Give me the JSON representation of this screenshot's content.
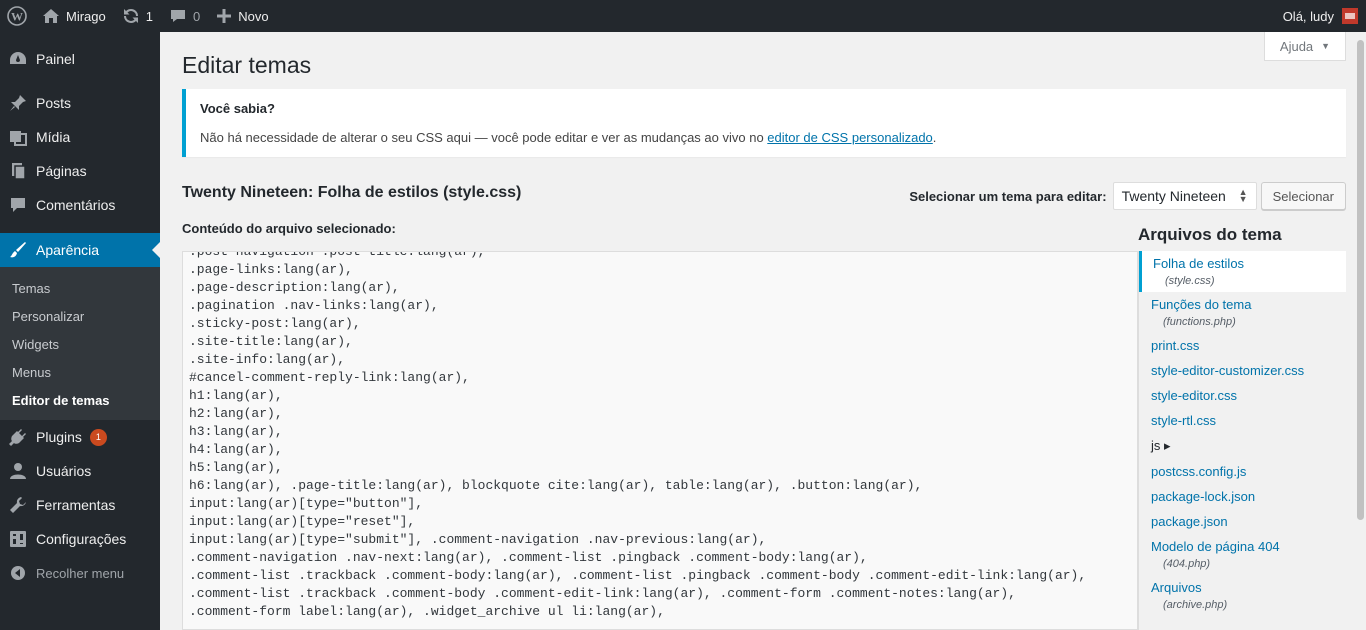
{
  "adminbar": {
    "site_name": "Mirago",
    "updates_count": "1",
    "comments_count": "0",
    "new_label": "Novo",
    "greeting": "Olá, ludy"
  },
  "sidebar": {
    "items": [
      {
        "label": "Painel",
        "icon": "dashboard-icon"
      },
      {
        "label": "Posts",
        "icon": "pin-icon"
      },
      {
        "label": "Mídia",
        "icon": "media-icon"
      },
      {
        "label": "Páginas",
        "icon": "page-icon"
      },
      {
        "label": "Comentários",
        "icon": "comment-icon"
      },
      {
        "label": "Aparência",
        "icon": "brush-icon"
      }
    ],
    "submenu": [
      "Temas",
      "Personalizar",
      "Widgets",
      "Menus",
      "Editor de temas"
    ],
    "items_after": [
      {
        "label": "Plugins",
        "badge": "1",
        "icon": "plugin-icon"
      },
      {
        "label": "Usuários",
        "icon": "user-icon"
      },
      {
        "label": "Ferramentas",
        "icon": "wrench-icon"
      },
      {
        "label": "Configurações",
        "icon": "settings-icon"
      }
    ],
    "collapse_label": "Recolher menu"
  },
  "help_label": "Ajuda",
  "page_title": "Editar temas",
  "notice": {
    "title": "Você sabia?",
    "text_before": "Não há necessidade de alterar o seu CSS aqui — você pode editar e ver as mudanças ao vivo no ",
    "link": "editor de CSS personalizado",
    "text_after": "."
  },
  "file_heading": "Twenty Nineteen: Folha de estilos (style.css)",
  "theme_select": {
    "label": "Selecionar um tema para editar:",
    "value": "Twenty Nineteen",
    "button": "Selecionar"
  },
  "content_label": "Conteúdo do arquivo selecionado:",
  "code_lines": [
    ".post-navigation .post-title:lang(ar),",
    ".page-links:lang(ar),",
    ".page-description:lang(ar),",
    ".pagination .nav-links:lang(ar),",
    ".sticky-post:lang(ar),",
    ".site-title:lang(ar),",
    ".site-info:lang(ar),",
    "#cancel-comment-reply-link:lang(ar),",
    "h1:lang(ar),",
    "h2:lang(ar),",
    "h3:lang(ar),",
    "h4:lang(ar),",
    "h5:lang(ar),",
    "h6:lang(ar), .page-title:lang(ar), blockquote cite:lang(ar), table:lang(ar), .button:lang(ar),",
    "input:lang(ar)[type=\"button\"],",
    "input:lang(ar)[type=\"reset\"],",
    "input:lang(ar)[type=\"submit\"], .comment-navigation .nav-previous:lang(ar),",
    ".comment-navigation .nav-next:lang(ar), .comment-list .pingback .comment-body:lang(ar),",
    ".comment-list .trackback .comment-body:lang(ar), .comment-list .pingback .comment-body .comment-edit-link:lang(ar),",
    ".comment-list .trackback .comment-body .comment-edit-link:lang(ar), .comment-form .comment-notes:lang(ar),",
    ".comment-form label:lang(ar), .widget_archive ul li:lang(ar),"
  ],
  "files_title": "Arquivos do tema",
  "files": [
    {
      "name": "Folha de estilos",
      "sub": "(style.css)"
    },
    {
      "name": "Funções do tema",
      "sub": "(functions.php)"
    },
    {
      "name": "print.css"
    },
    {
      "name": "style-editor-customizer.css"
    },
    {
      "name": "style-editor.css"
    },
    {
      "name": "style-rtl.css"
    },
    {
      "name": "js ▸"
    },
    {
      "name": "postcss.config.js"
    },
    {
      "name": "package-lock.json"
    },
    {
      "name": "package.json"
    },
    {
      "name": "Modelo de página 404",
      "sub": "(404.php)"
    },
    {
      "name": "Arquivos",
      "sub": "(archive.php)"
    }
  ]
}
